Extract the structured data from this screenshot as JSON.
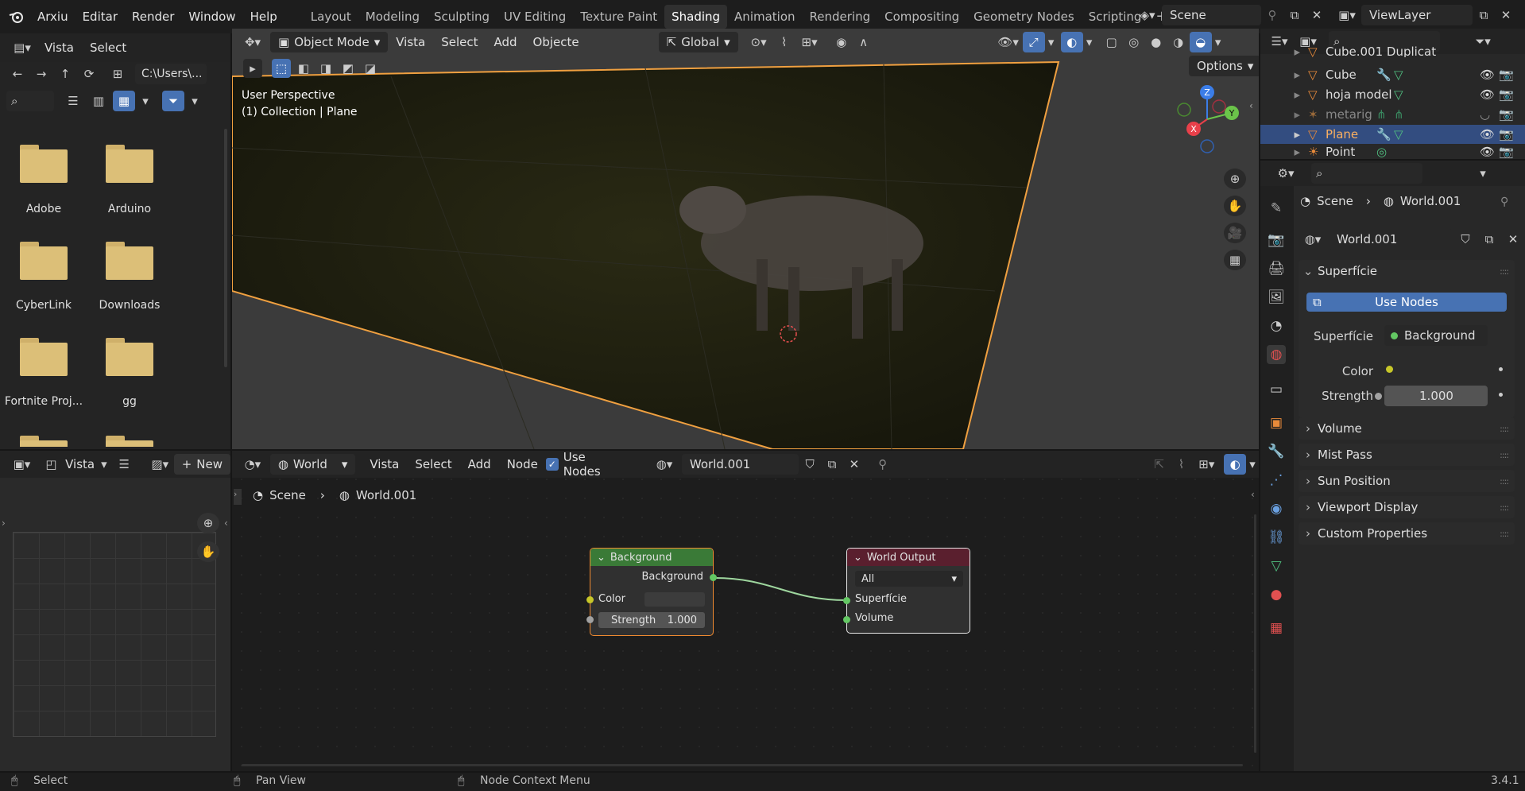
{
  "topbar": {
    "menus": [
      "Arxiu",
      "Editar",
      "Render",
      "Window",
      "Help"
    ],
    "workspaces": [
      "Layout",
      "Modeling",
      "Sculpting",
      "UV Editing",
      "Texture Paint",
      "Shading",
      "Animation",
      "Rendering",
      "Compositing",
      "Geometry Nodes",
      "Scripting"
    ],
    "active_workspace": "Shading",
    "add_workspace": "+",
    "scene": "Scene",
    "view_layer": "ViewLayer"
  },
  "file_browser": {
    "menus": [
      "Vista",
      "Select"
    ],
    "path": "C:\\Users\\...",
    "folders": [
      "Adobe",
      "Arduino",
      "CyberLink",
      "Downloads",
      "Fortnite Proj...",
      "gg"
    ]
  },
  "viewport": {
    "mode": "Object Mode",
    "menus": [
      "Vista",
      "Select",
      "Add",
      "Objecte"
    ],
    "orientation": "Global",
    "options": "Options",
    "perspective": "User Perspective",
    "collection": "(1) Collection | Plane",
    "gizmo": {
      "z": "Z",
      "y": "Y",
      "x": "X"
    }
  },
  "outliner": {
    "rows": [
      {
        "name": "Cube.001 Duplicat",
        "selected": false
      },
      {
        "name": "Cube",
        "selected": false
      },
      {
        "name": "hoja model",
        "selected": false
      },
      {
        "name": "metarig",
        "selected": false
      },
      {
        "name": "Plane",
        "selected": true
      },
      {
        "name": "Point",
        "selected": false
      }
    ]
  },
  "properties": {
    "breadcrumb_scene": "Scene",
    "breadcrumb_world": "World.001",
    "world_name": "World.001",
    "surface_panel": "Superfície",
    "use_nodes": "Use Nodes",
    "surface_label": "Superfície",
    "surface_value": "Background",
    "color_label": "Color",
    "strength_label": "Strength",
    "strength_value": "1.000",
    "panels": [
      "Volume",
      "Mist Pass",
      "Sun Position",
      "Viewport Display",
      "Custom Properties"
    ]
  },
  "image_editor": {
    "view_menu": "Vista",
    "new_button": "New"
  },
  "node_editor": {
    "world_type": "World",
    "menus": [
      "Vista",
      "Select",
      "Add",
      "Node"
    ],
    "use_nodes": "Use Nodes",
    "world_name": "World.001",
    "breadcrumb_scene": "Scene",
    "breadcrumb_world": "World.001",
    "background_node": {
      "title": "Background",
      "output": "Background",
      "color": "Color",
      "strength_label": "Strength",
      "strength_value": "1.000"
    },
    "output_node": {
      "title": "World Output",
      "target": "All",
      "surface": "Superfície",
      "volume": "Volume"
    }
  },
  "status_bar": {
    "select": "Select",
    "pan": "Pan View",
    "context": "Node Context Menu",
    "version": "3.4.1"
  },
  "colors": {
    "accent_blue": "#4772b3",
    "selection_orange": "#f0a040",
    "node_background_header": "#3a7a37",
    "node_output_header": "#5a1f2e",
    "socket_green": "#63c763",
    "socket_yellow": "#c7c729"
  }
}
